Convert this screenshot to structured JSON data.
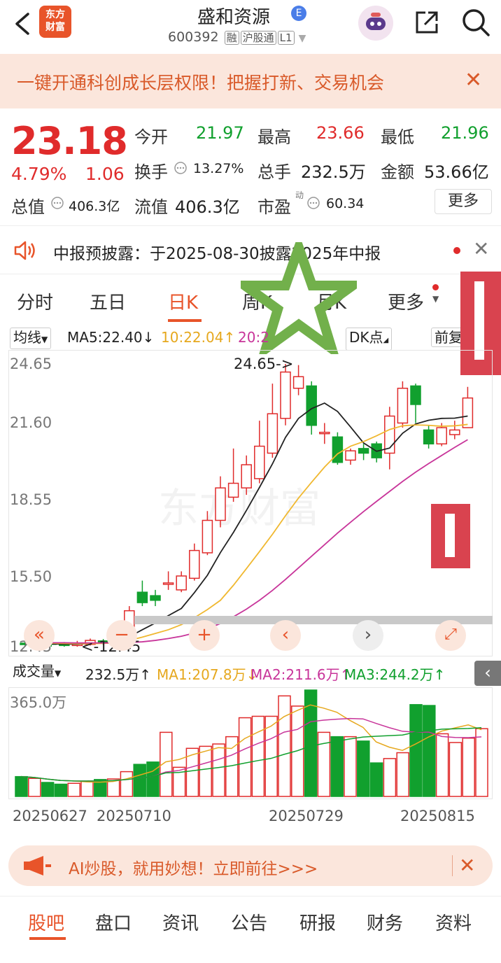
{
  "header": {
    "logo_line1": "东方",
    "logo_line2": "财富",
    "title": "盛和资源",
    "title_badge": "E",
    "code": "600392",
    "tags": [
      "融",
      "沪股通",
      "L1"
    ],
    "icons": [
      "back-arrow-icon",
      "avatar-icon",
      "share-icon",
      "search-icon"
    ]
  },
  "promo": {
    "text": "一键开通科创成长层权限！把握打新、交易机会",
    "close": "✕"
  },
  "quote": {
    "price": "23.18",
    "change_pct": "4.79%",
    "change": "1.06",
    "open_label": "今开",
    "open": "21.97",
    "high_label": "最高",
    "high": "23.66",
    "low_label": "最低",
    "low": "21.96",
    "turnover_label": "换手",
    "turnover": "13.27%",
    "volume_label": "总手",
    "volume": "232.5万",
    "amount_label": "金额",
    "amount": "53.66亿",
    "mktcap_label": "总值",
    "mktcap": "406.3亿",
    "float_label": "流值",
    "float": "406.3亿",
    "pe_label": "市盈",
    "pe_sup": "动",
    "pe": "60.34",
    "more": "更多",
    "colors": {
      "up": "#e02b2b",
      "down": "#11a02e"
    }
  },
  "notice": {
    "text": "中报预披露：于2025-08-30披露2025年中报",
    "close": "✕"
  },
  "tabs": [
    "分时",
    "五日",
    "日K",
    "周K",
    "月K",
    "更多"
  ],
  "active_tab": "日K",
  "ma_bar": {
    "selector": "均线",
    "ma5": "MA5:22.40↓",
    "ma10": "10:22.04↑",
    "ma20": "20:2",
    "dk": "DK点",
    "adjust": "前复权"
  },
  "chart_data": {
    "type": "candlestick",
    "y_ticks": [
      "24.65",
      "21.60",
      "18.55",
      "15.50",
      "12.45"
    ],
    "ylim": [
      12.45,
      24.65
    ],
    "max_label": "24.65->",
    "min_label": "<-12.45",
    "candles": [
      {
        "o": 12.6,
        "c": 12.55,
        "h": 12.7,
        "l": 12.45
      },
      {
        "o": 12.55,
        "c": 12.6,
        "h": 12.7,
        "l": 12.45
      },
      {
        "o": 12.62,
        "c": 12.55,
        "h": 12.7,
        "l": 12.45
      },
      {
        "o": 12.58,
        "c": 12.5,
        "h": 12.65,
        "l": 12.45
      },
      {
        "o": 12.5,
        "c": 12.6,
        "h": 12.7,
        "l": 12.45
      },
      {
        "o": 12.55,
        "c": 12.72,
        "h": 12.8,
        "l": 12.5
      },
      {
        "o": 12.7,
        "c": 12.6,
        "h": 12.78,
        "l": 12.52
      },
      {
        "o": 12.6,
        "c": 12.95,
        "h": 13.1,
        "l": 12.55
      },
      {
        "o": 13.0,
        "c": 14.0,
        "h": 14.2,
        "l": 12.95
      },
      {
        "o": 14.8,
        "c": 14.35,
        "h": 15.3,
        "l": 14.2
      },
      {
        "o": 14.65,
        "c": 14.45,
        "h": 14.9,
        "l": 14.2
      },
      {
        "o": 15.15,
        "c": 15.2,
        "h": 15.7,
        "l": 14.9
      },
      {
        "o": 14.9,
        "c": 15.5,
        "h": 15.7,
        "l": 14.8
      },
      {
        "o": 15.4,
        "c": 16.6,
        "h": 16.9,
        "l": 15.3
      },
      {
        "o": 16.5,
        "c": 17.9,
        "h": 18.3,
        "l": 16.4
      },
      {
        "o": 17.9,
        "c": 19.3,
        "h": 19.8,
        "l": 17.6
      },
      {
        "o": 18.9,
        "c": 19.5,
        "h": 21.0,
        "l": 18.7
      },
      {
        "o": 19.3,
        "c": 20.3,
        "h": 20.7,
        "l": 19.0
      },
      {
        "o": 19.7,
        "c": 21.1,
        "h": 22.2,
        "l": 19.5
      },
      {
        "o": 20.8,
        "c": 22.5,
        "h": 23.8,
        "l": 20.6
      },
      {
        "o": 22.3,
        "c": 24.3,
        "h": 24.65,
        "l": 22.0
      },
      {
        "o": 23.6,
        "c": 24.1,
        "h": 24.6,
        "l": 23.3
      },
      {
        "o": 23.7,
        "c": 22.0,
        "h": 23.9,
        "l": 21.6
      },
      {
        "o": 21.7,
        "c": 21.7,
        "h": 22.1,
        "l": 21.2
      },
      {
        "o": 21.5,
        "c": 20.4,
        "h": 21.7,
        "l": 20.3
      },
      {
        "o": 20.5,
        "c": 20.9,
        "h": 21.0,
        "l": 20.3
      },
      {
        "o": 21.0,
        "c": 20.8,
        "h": 21.2,
        "l": 20.5
      },
      {
        "o": 21.2,
        "c": 20.6,
        "h": 21.3,
        "l": 20.4
      },
      {
        "o": 20.8,
        "c": 22.4,
        "h": 22.8,
        "l": 20.1
      },
      {
        "o": 22.1,
        "c": 23.6,
        "h": 23.9,
        "l": 21.9
      },
      {
        "o": 23.7,
        "c": 22.9,
        "h": 23.8,
        "l": 22.1
      },
      {
        "o": 21.8,
        "c": 21.2,
        "h": 22.0,
        "l": 21.0
      },
      {
        "o": 21.2,
        "c": 21.9,
        "h": 22.1,
        "l": 21.1
      },
      {
        "o": 21.6,
        "c": 21.8,
        "h": 22.2,
        "l": 21.4
      },
      {
        "o": 21.9,
        "c": 23.18,
        "h": 23.66,
        "l": 21.96
      }
    ],
    "ma_lines": [
      {
        "name": "MA5",
        "color": "#222222",
        "values": [
          12.57,
          12.57,
          12.57,
          12.56,
          12.56,
          12.59,
          12.61,
          12.68,
          12.88,
          13.18,
          13.47,
          13.79,
          14.1,
          14.78,
          15.53,
          16.51,
          17.38,
          18.33,
          19.32,
          20.34,
          21.48,
          22.3,
          22.72,
          22.96,
          22.6,
          21.93,
          21.24,
          20.88,
          21.02,
          21.66,
          22.06,
          22.22,
          22.3,
          22.31,
          22.4
        ]
      },
      {
        "name": "MA10",
        "color": "#f0b830",
        "values": [
          12.6,
          12.6,
          12.6,
          12.59,
          12.58,
          12.58,
          12.59,
          12.62,
          12.72,
          12.86,
          13.02,
          13.18,
          13.4,
          13.7,
          14.05,
          14.45,
          15.1,
          15.82,
          16.55,
          17.3,
          18.1,
          18.86,
          19.54,
          20.2,
          20.77,
          21.1,
          21.3,
          21.55,
          21.82,
          21.98,
          22.02,
          22.0,
          21.96,
          21.98,
          22.04
        ]
      },
      {
        "name": "MA20",
        "color": "#c8359a",
        "values": [
          12.62,
          12.62,
          12.62,
          12.62,
          12.61,
          12.61,
          12.61,
          12.62,
          12.63,
          12.66,
          12.72,
          12.8,
          12.9,
          13.04,
          13.22,
          13.45,
          13.74,
          14.07,
          14.45,
          14.88,
          15.35,
          15.85,
          16.35,
          16.85,
          17.35,
          17.82,
          18.28,
          18.72,
          19.15,
          19.58,
          19.98,
          20.35,
          20.7,
          21.05,
          21.38
        ]
      }
    ],
    "volume": {
      "label": "成交量",
      "current": "232.5万↑",
      "ma1": "MA1:207.8万↓",
      "ma2": "MA2:211.6万↑",
      "ma3": "MA3:244.2万↑",
      "y_tick": "365.0万",
      "ymax": 365.0,
      "values": [
        68,
        62,
        48,
        42,
        45,
        52,
        58,
        60,
        85,
        110,
        118,
        220,
        100,
        165,
        172,
        180,
        205,
        270,
        275,
        275,
        345,
        310,
        365,
        220,
        205,
        205,
        190,
        115,
        130,
        150,
        315,
        312,
        215,
        185,
        200,
        232.5
      ]
    },
    "x_labels": [
      "20250627",
      "20250710",
      "20250729",
      "20250815"
    ]
  },
  "chart_controls": [
    "«",
    "−",
    "+",
    "‹",
    "›",
    "⤢"
  ],
  "ai_banner": {
    "text": "AI炒股，就用妙想！立即前往>>>",
    "close": "✕"
  },
  "bottom_tabs": [
    "股吧",
    "盘口",
    "资讯",
    "公告",
    "研报",
    "财务",
    "资料"
  ],
  "active_bottom_tab": "股吧"
}
